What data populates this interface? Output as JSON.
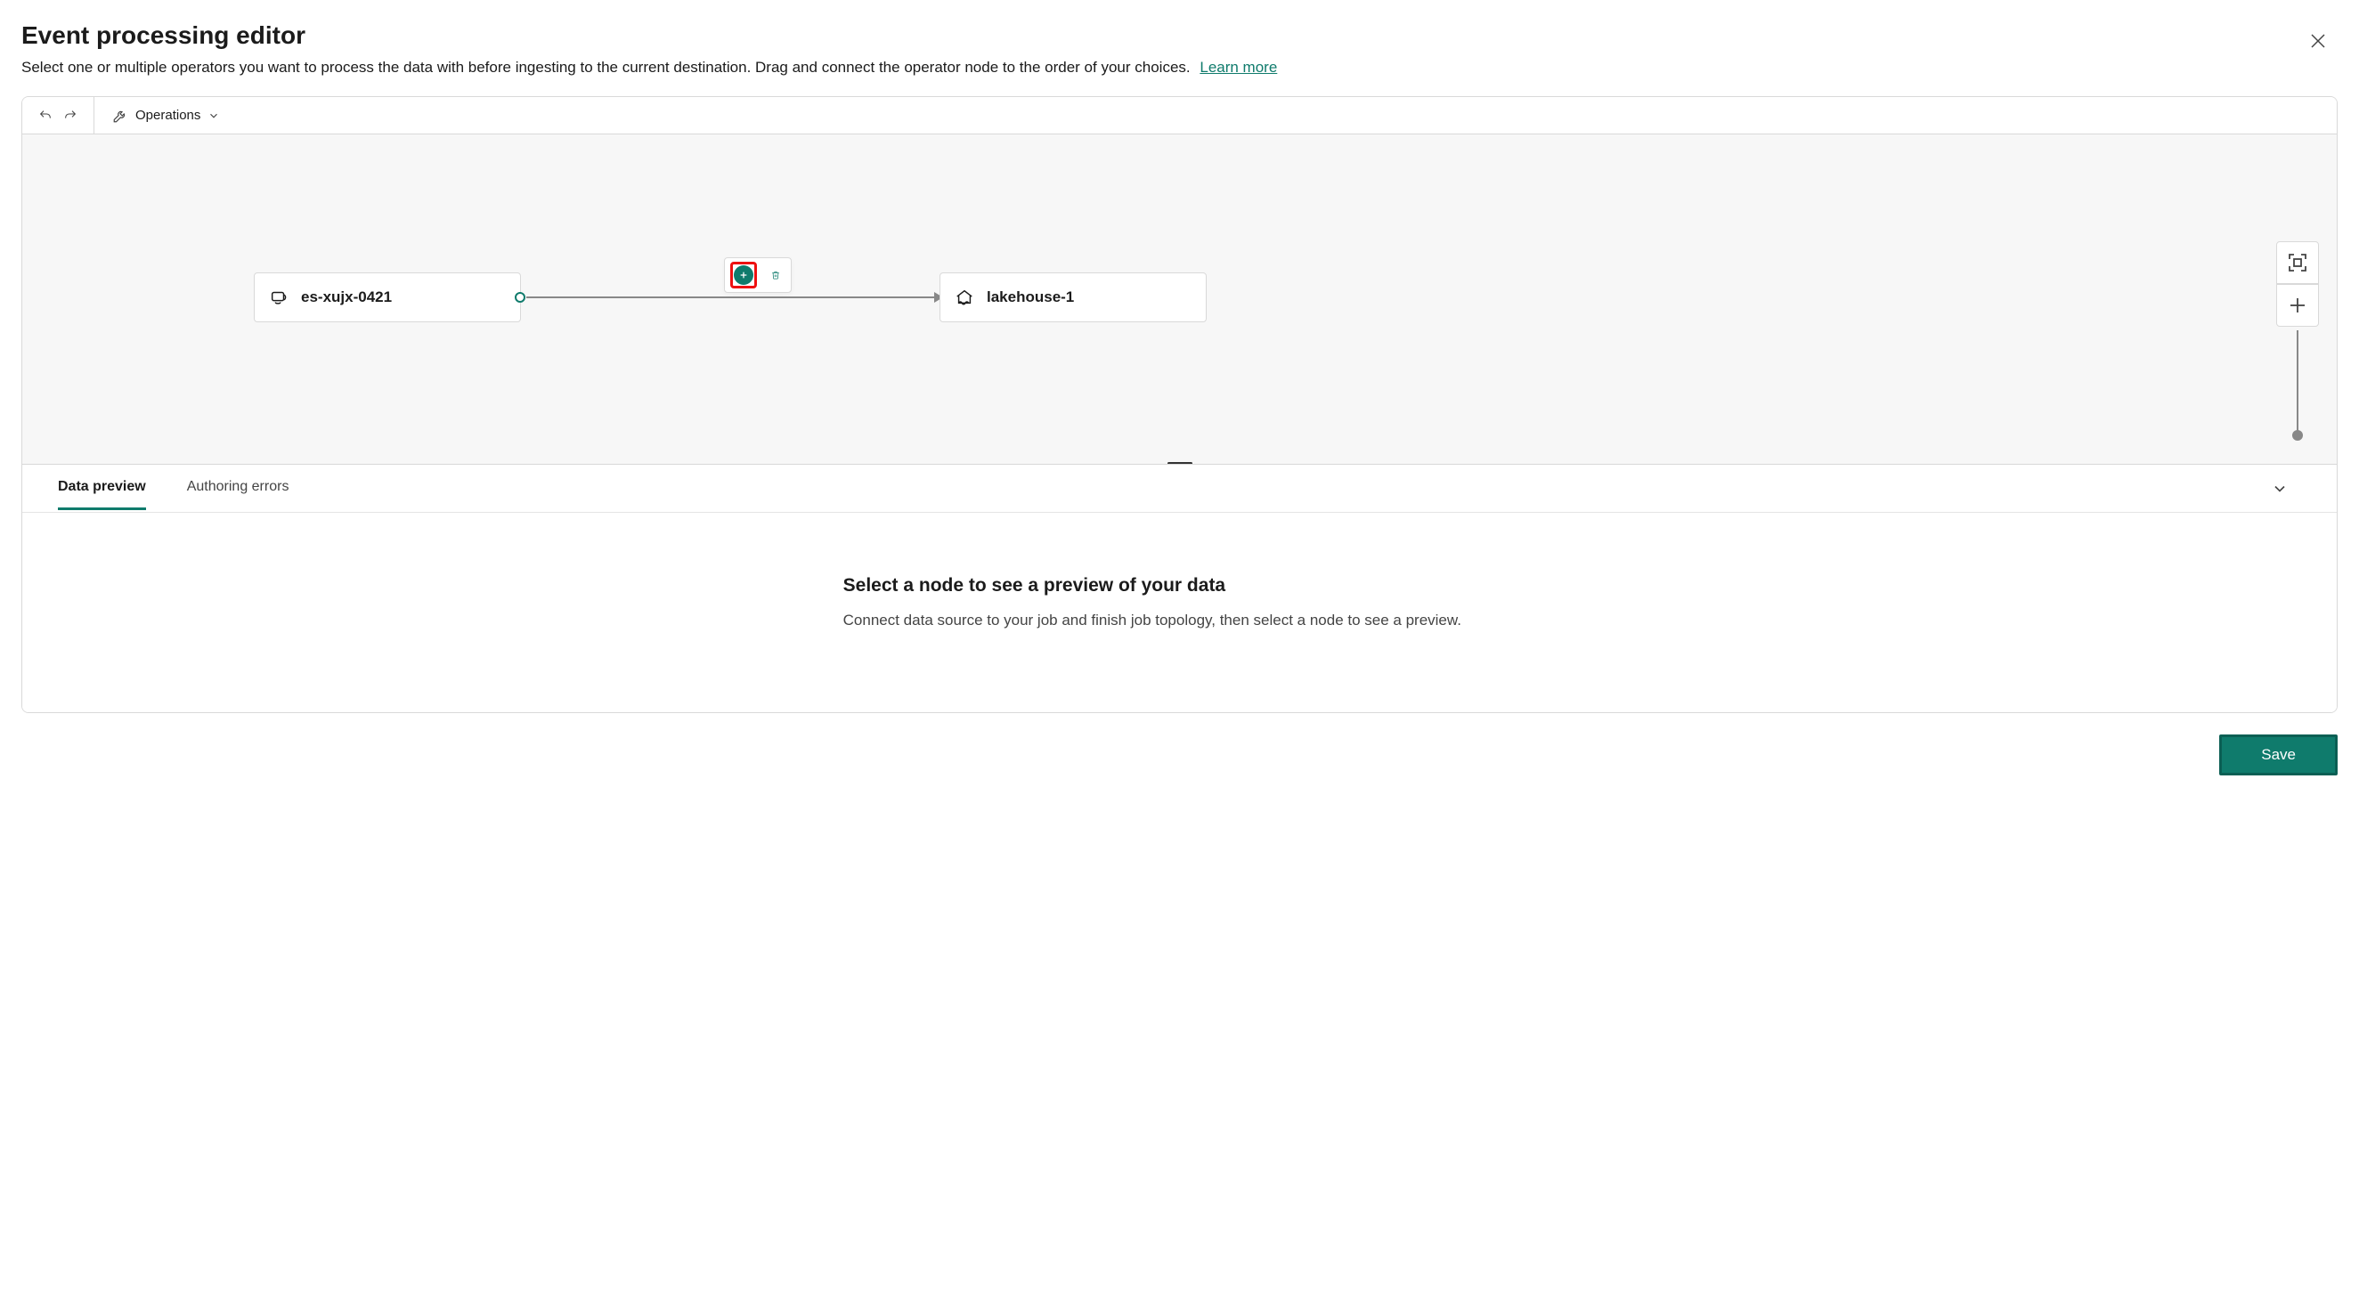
{
  "header": {
    "title": "Event processing editor",
    "subtitle": "Select one or multiple operators you want to process the data with before ingesting to the current destination. Drag and connect the operator node to the order of your choices.",
    "learn_more": "Learn more"
  },
  "toolbar": {
    "undo_title": "Undo",
    "redo_title": "Redo",
    "operations_label": "Operations"
  },
  "canvas": {
    "source_node": {
      "label": "es-xujx-0421"
    },
    "dest_node": {
      "label": "lakehouse-1"
    },
    "edge_actions": {
      "add_title": "Add operator",
      "delete_title": "Delete"
    },
    "controls": {
      "fit_title": "Fit to screen",
      "zoom_in_title": "Zoom in"
    }
  },
  "bottom_panel": {
    "tabs": {
      "data_preview": "Data preview",
      "authoring_errors": "Authoring errors"
    },
    "empty": {
      "heading": "Select a node to see a preview of your data",
      "text": "Connect data source to your job and finish job topology, then select a node to see a preview."
    }
  },
  "footer": {
    "save": "Save"
  },
  "colors": {
    "accent": "#0f7b6c",
    "highlight": "#e11"
  },
  "icons": {
    "close": "close-icon",
    "undo": "undo-icon",
    "redo": "redo-icon",
    "wrench": "wrench-icon",
    "chevron_down": "chevron-down-icon",
    "stream": "stream-source-icon",
    "lakehouse": "lakehouse-icon",
    "plus": "plus-icon",
    "trash": "trash-icon",
    "fit": "fit-screen-icon"
  }
}
